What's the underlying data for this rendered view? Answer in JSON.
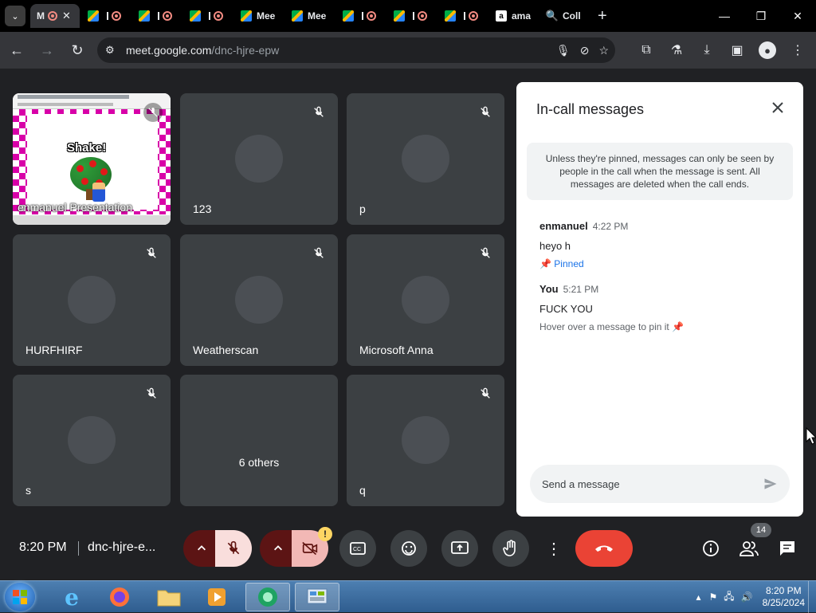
{
  "browser": {
    "tabs": [
      {
        "label": "M",
        "kind": "meet",
        "active": true
      },
      {
        "label": "",
        "kind": "meet"
      },
      {
        "label": "",
        "kind": "meet"
      },
      {
        "label": "",
        "kind": "meet"
      },
      {
        "label": "Mee",
        "kind": "meet-text"
      },
      {
        "label": "Mee",
        "kind": "meet-text"
      },
      {
        "label": "",
        "kind": "meet"
      },
      {
        "label": "",
        "kind": "meet"
      },
      {
        "label": "",
        "kind": "meet"
      },
      {
        "label": "ama",
        "kind": "amazon"
      },
      {
        "label": "Coll",
        "kind": "google"
      }
    ],
    "url_host": "meet.google.com",
    "url_path": "/dnc-hjre-epw"
  },
  "tiles": [
    {
      "name": "enmanuel Presentation",
      "type": "presentation",
      "game_text": "Shake!"
    },
    {
      "name": "123",
      "type": "avatar"
    },
    {
      "name": "p",
      "type": "avatar"
    },
    {
      "name": "HURFHIRF",
      "type": "avatar"
    },
    {
      "name": "Weatherscan",
      "type": "avatar"
    },
    {
      "name": "Microsoft Anna",
      "type": "avatar"
    },
    {
      "name": "s",
      "type": "avatar"
    },
    {
      "name": "6 others",
      "type": "others"
    },
    {
      "name": "q",
      "type": "avatar"
    }
  ],
  "chat": {
    "title": "In-call messages",
    "notice": "Unless they're pinned, messages can only be seen by people in the call when the message is sent. All messages are deleted when the call ends.",
    "messages": [
      {
        "sender": "enmanuel",
        "time": "4:22 PM",
        "text": "heyo h",
        "status": "Pinned"
      },
      {
        "sender": "You",
        "time": "5:21 PM",
        "text": "FUCK YOU",
        "status": "Hover over a message to pin it"
      }
    ],
    "input_placeholder": "Send a message"
  },
  "controls": {
    "time": "8:20 PM",
    "meeting_code": "dnc-hjre-e...",
    "warning_badge": "!",
    "people_count": "14"
  },
  "taskbar": {
    "time": "8:20 PM",
    "date": "8/25/2024"
  },
  "colors": {
    "meet_bg": "#202124",
    "tile_bg": "#3c4043",
    "end_call": "#ea4335",
    "pinned_blue": "#1a73e8"
  }
}
